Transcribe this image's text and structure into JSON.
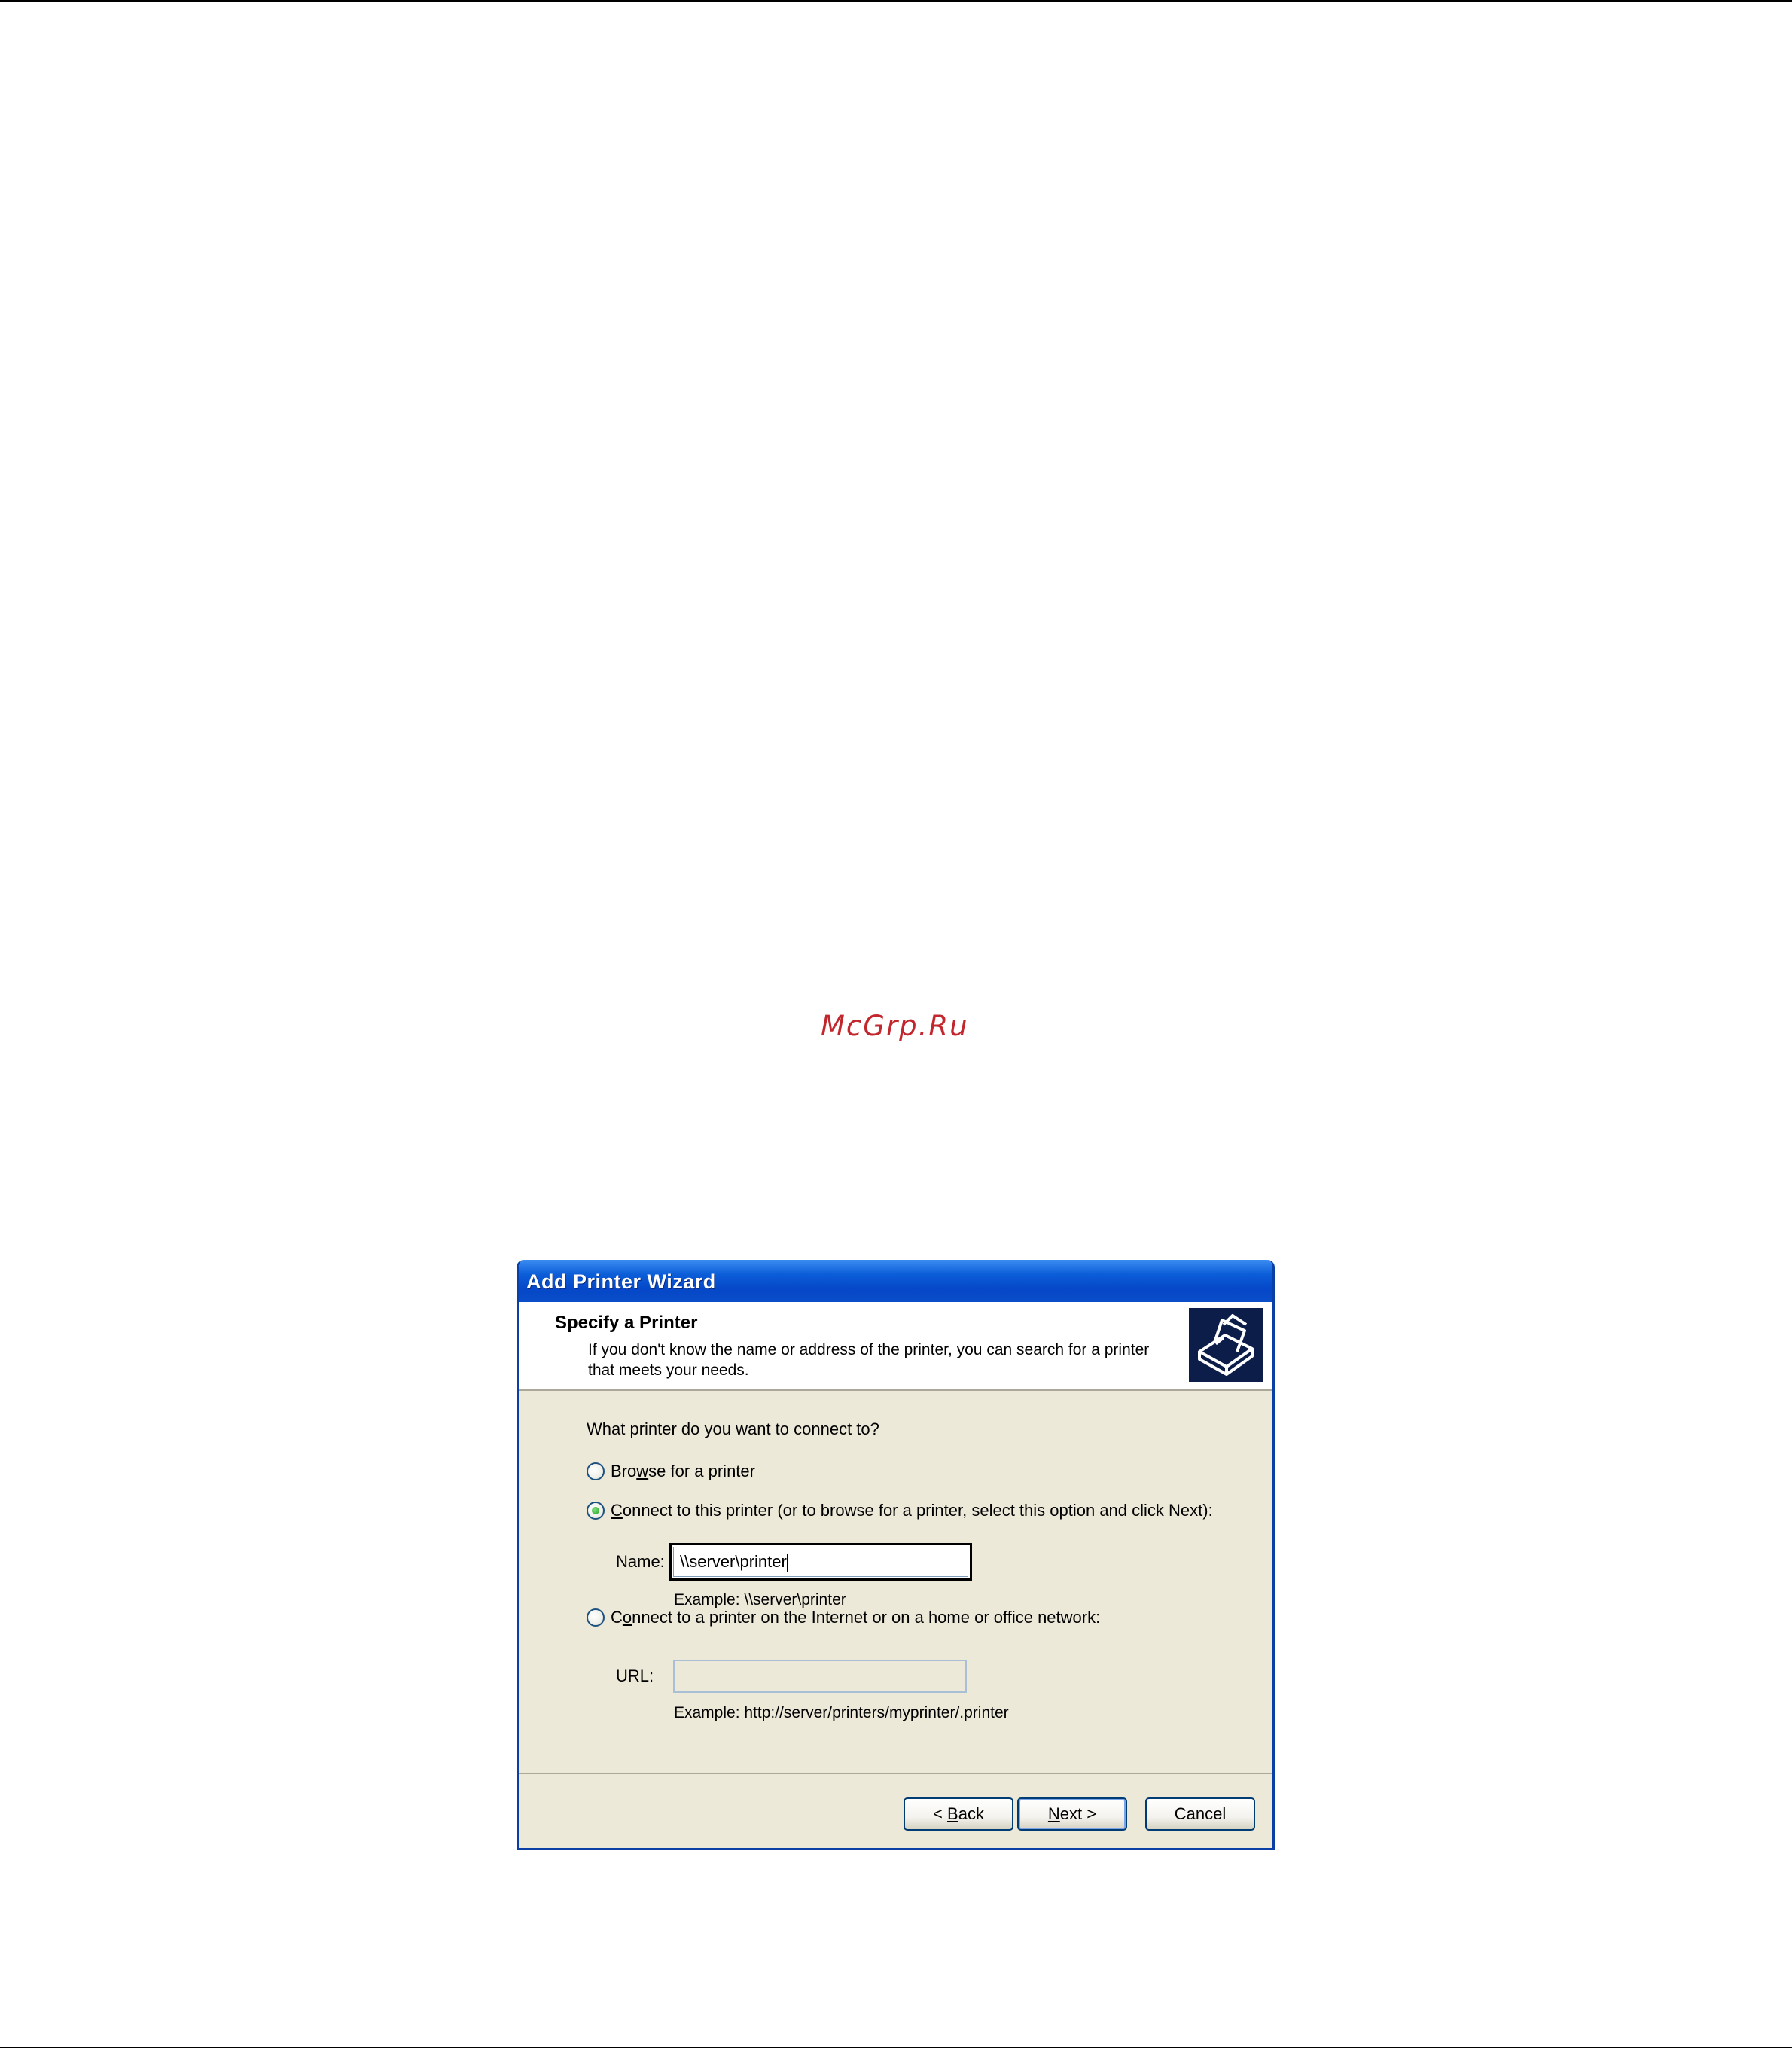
{
  "watermark": "McGrp.Ru",
  "dialog": {
    "title": "Add Printer Wizard",
    "header_title": "Specify a Printer",
    "header_description": "If you don't know the name or address of the printer, you can search for a printer that meets your needs.",
    "header_icon": "printer-icon",
    "question": "What printer do you want to connect to?",
    "options": [
      {
        "mnemonic": "w",
        "pre": "Bro",
        "post": "se for a printer",
        "checked": false
      },
      {
        "mnemonic": "C",
        "pre": "",
        "post": "onnect to this printer (or to browse for a printer, select this option and click Next):",
        "checked": true
      },
      {
        "mnemonic": "o",
        "pre": "C",
        "post": "nnect to a printer on the Internet or on a home or office network:",
        "checked": false
      }
    ],
    "name_label": "Name:",
    "name_value": "\\\\server\\printer",
    "name_example": "Example: \\\\server\\printer",
    "url_label": "URL:",
    "url_value": "",
    "url_example": "Example: http://server/printers/myprinter/.printer",
    "buttons": {
      "back": {
        "pre": "< ",
        "mnemonic": "B",
        "post": "ack"
      },
      "next": {
        "pre": "",
        "mnemonic": "N",
        "post": "ext >"
      },
      "cancel": "Cancel"
    }
  },
  "colors": {
    "titlebar": "#0b5dd8",
    "dialog_bg": "#ece9d8",
    "watermark": "#c1272d"
  }
}
